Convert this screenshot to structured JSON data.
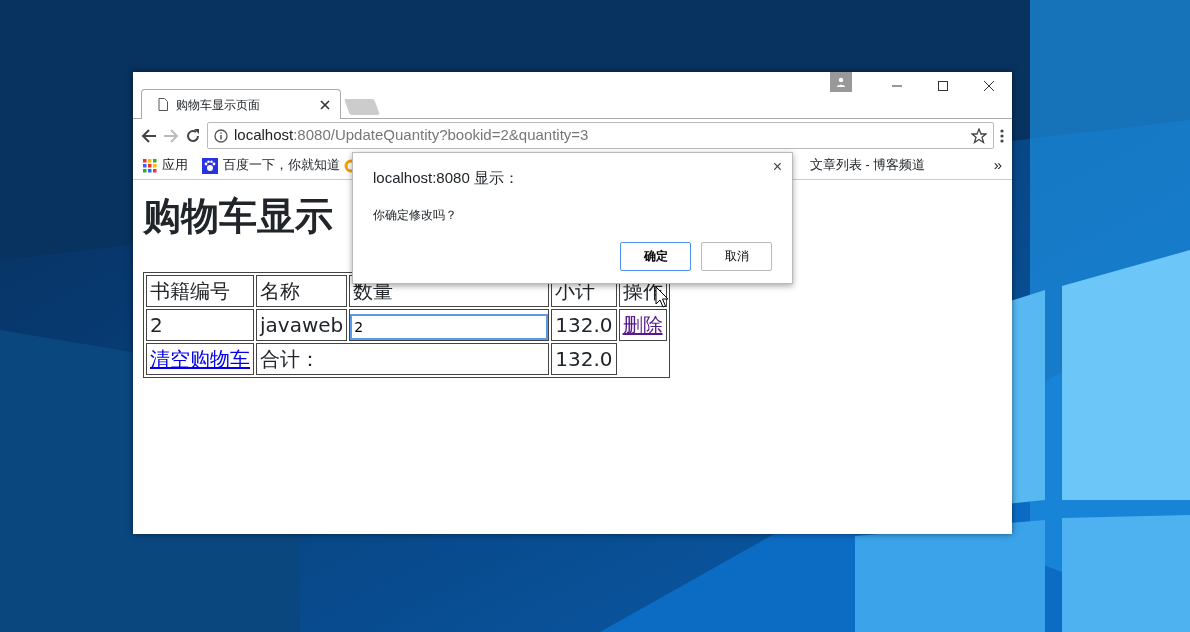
{
  "browser": {
    "tabs": [
      {
        "title": "购物车显示页面",
        "selected": true
      }
    ],
    "address": {
      "host": "localhost",
      "path": ":8080/UpdateQuantity?bookid=2&quantity=3"
    },
    "bookmarks": [
      {
        "kind": "apps",
        "label": "应用"
      },
      {
        "kind": "paw",
        "label": "百度一下，你就知道"
      },
      {
        "kind": "ring"
      },
      {
        "kind": "plain",
        "label": "文章列表 - 博客频道"
      }
    ],
    "bookmarks_overflow": "»"
  },
  "page": {
    "heading": "购物车显示",
    "columns": [
      "书籍编号",
      "名称",
      "数量",
      "小计",
      "操作"
    ],
    "rows": [
      {
        "book_id": "2",
        "name": "javaweb",
        "quantity": "2",
        "subtotal": "132.0",
        "action": "删除",
        "action_visited": true
      }
    ],
    "footer": {
      "clear_link": "清空购物车",
      "clear_visited": false,
      "total_label": "合计：",
      "total": "132.0"
    }
  },
  "dialog": {
    "title": "localhost:8080 显示：",
    "close": "×",
    "message": "你确定修改吗？",
    "buttons": [
      {
        "label": "确定",
        "primary": true
      },
      {
        "label": "取消",
        "primary": false
      }
    ]
  }
}
